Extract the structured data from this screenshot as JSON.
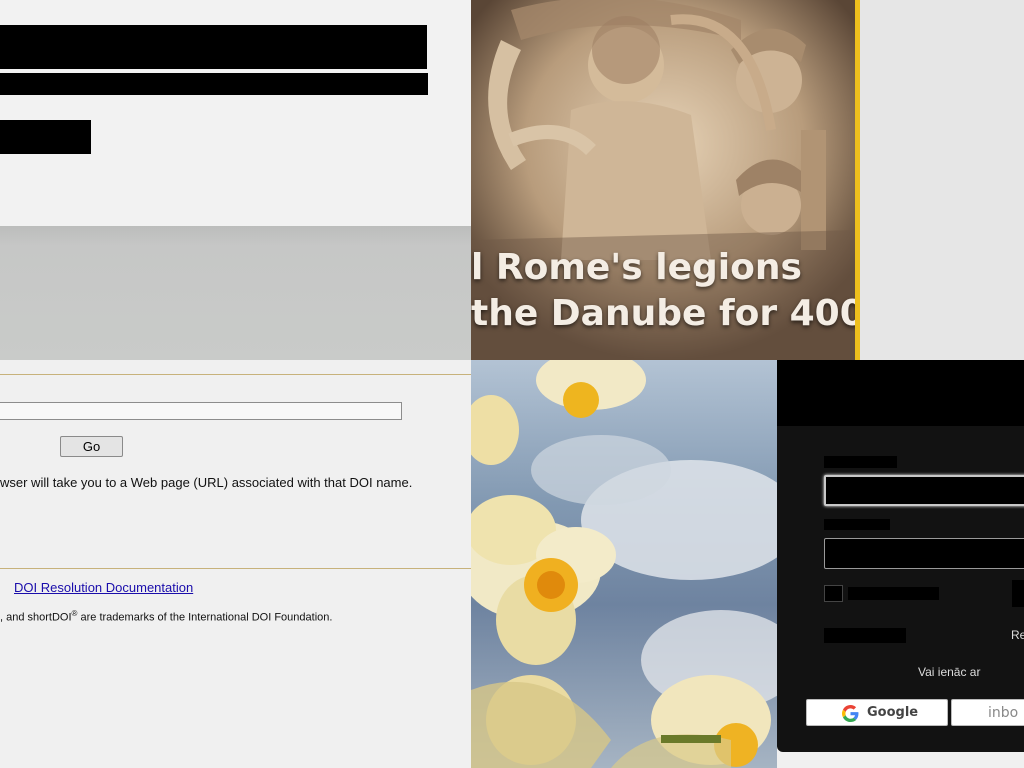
{
  "tiles": {
    "roman": {
      "headline_line1": "l Rome's legions",
      "headline_line2": "the Danube for 400",
      "accent_color": "#eebf1d"
    },
    "doi": {
      "go_label": "Go",
      "input_value": "",
      "description": "wser will take you to a Web page (URL) associated with that DOI name.",
      "doc_link": "DOI Resolution Documentation",
      "trademark_prefix": ", and shortDOI",
      "trademark_mark": "®",
      "trademark_suffix": " are trademarks of the International DOI Foundation.",
      "rule_color": "#c7b27b",
      "link_color": "#1a0dab"
    },
    "login": {
      "remember_partial": "Re",
      "alt_text": "Vai ienāc ar",
      "google_label": "Google",
      "inbox_label": "inbo"
    }
  },
  "icons": {
    "google": "google-g-icon"
  }
}
